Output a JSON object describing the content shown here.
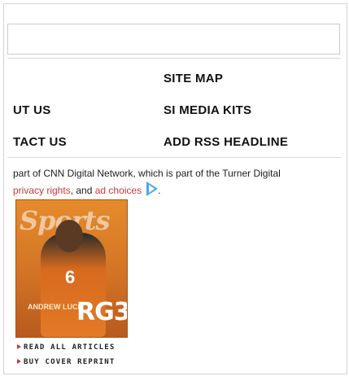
{
  "footer_links": {
    "left": [
      "UT US",
      "TACT US"
    ],
    "right": [
      "SITE MAP",
      "SI MEDIA KITS",
      "ADD RSS HEADLINE"
    ]
  },
  "legal": {
    "line1": "part of CNN Digital Network, which is part of the Turner Digital",
    "privacy_rights": "privacy rights",
    "and_text": ", and ",
    "ad_choices": "ad choices",
    "end_text": "."
  },
  "cover": {
    "masthead": "Sports",
    "jersey_number": "6",
    "headline": "RG3",
    "subhead": "ANDREW LUCK",
    "read_all": "READ ALL ARTICLES",
    "buy_reprint": "BUY COVER REPRINT"
  },
  "colors": {
    "link_red": "#c63a3a",
    "adchoices_blue": "#4aa8e0"
  },
  "icons": {
    "ad_choices": "adchoices-icon",
    "bullet": "triangle-bullet-icon"
  }
}
